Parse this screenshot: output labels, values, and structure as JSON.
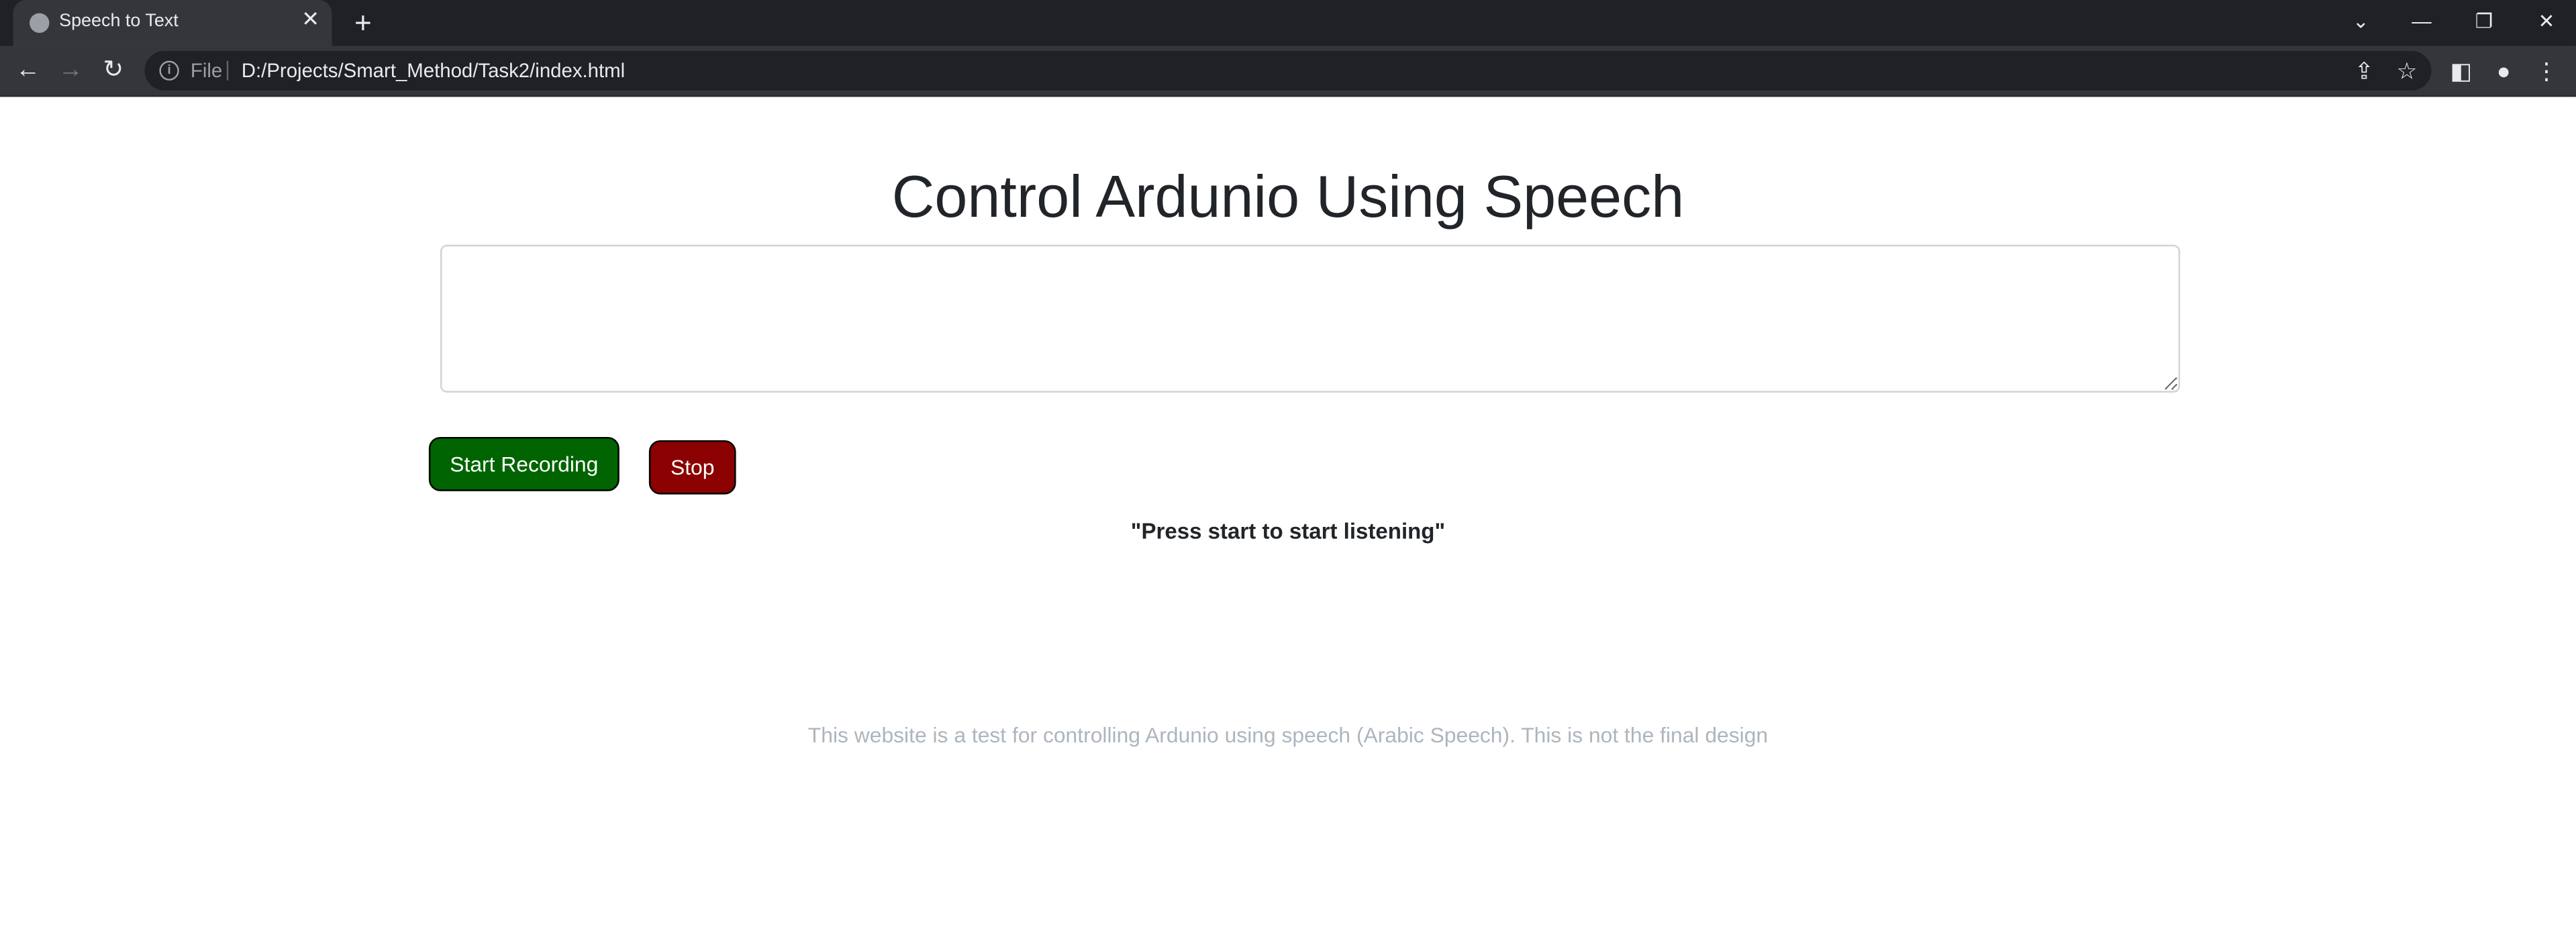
{
  "browser": {
    "tab": {
      "title": "Speech to Text",
      "favicon": "globe-icon",
      "close": "✕"
    },
    "new_tab": "+",
    "window_controls": {
      "tab_search": "⌄",
      "minimize": "—",
      "restore": "❐",
      "close": "✕"
    },
    "nav": {
      "back": "←",
      "forward": "→",
      "reload": "↻"
    },
    "address": {
      "info": "i",
      "scheme": "File",
      "url": "D:/Projects/Smart_Method/Task2/index.html"
    },
    "toolbar_icons": {
      "share": "⇪",
      "bookmark": "☆",
      "side_panel": "◧",
      "profile": "●",
      "menu": "⋮"
    }
  },
  "page": {
    "title": "Control Ardunio Using Speech",
    "textarea_value": "",
    "start_button": "Start Recording",
    "stop_button": "Stop",
    "status": "\"Press start to start listening\"",
    "footer": "This website is a test for controlling Ardunio using speech (Arabic Speech). This is not the final design"
  },
  "colors": {
    "start_button_bg": "#006400",
    "stop_button_bg": "#8b0000",
    "footer_text": "#adb5bd",
    "browser_dark": "#202124"
  }
}
